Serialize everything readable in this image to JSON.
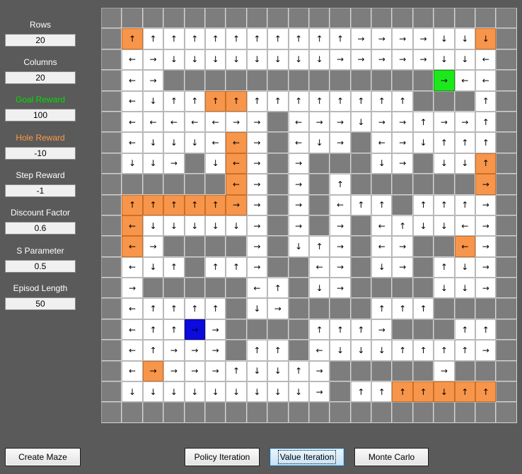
{
  "params": [
    {
      "id": "rows",
      "label": "Rows",
      "value": "20",
      "color": "#ffffff"
    },
    {
      "id": "columns",
      "label": "Columns",
      "value": "20",
      "color": "#ffffff"
    },
    {
      "id": "goal-reward",
      "label": "Goal Reward",
      "value": "100",
      "color": "#00e000"
    },
    {
      "id": "hole-reward",
      "label": "Hole Reward",
      "value": "-10",
      "color": "#ff9a40"
    },
    {
      "id": "step-reward",
      "label": "Step Reward",
      "value": "-1",
      "color": "#ffffff"
    },
    {
      "id": "discount-factor",
      "label": "Discount Factor",
      "value": "0.6",
      "color": "#ffffff"
    },
    {
      "id": "s-parameter",
      "label": "S Parameter",
      "value": "0.5",
      "color": "#ffffff"
    },
    {
      "id": "episod-length",
      "label": "Episod Length",
      "value": "50",
      "color": "#ffffff"
    }
  ],
  "buttons": {
    "create_maze": "Create Maze",
    "policy_iteration": "Policy Iteration",
    "value_iteration": "Value Iteration",
    "monte_carlo": "Monte Carlo",
    "active": "value_iteration"
  },
  "legend": {
    "w": "open-cell",
    "x": "wall-cell",
    "f": "hole-cell",
    "g": "goal-cell",
    "b": "agent-cell",
    "arrows": {
      "u": "↑",
      "d": "↓",
      "l": "←",
      "r": "→",
      "e": ""
    }
  },
  "colors": {
    "background": "#5a5a5a",
    "wall": "#7d7d7d",
    "open": "#ffffff",
    "hole": "#f7954a",
    "goal": "#1ce81c",
    "agent": "#0b0bde"
  },
  "maze": {
    "rows": 20,
    "cols": 20,
    "cells": [
      [
        "xe",
        "xe",
        "xe",
        "xe",
        "xe",
        "xe",
        "xe",
        "xe",
        "xe",
        "xe",
        "xe",
        "xe",
        "xe",
        "xe",
        "xe",
        "xe",
        "xe",
        "xe",
        "xe",
        "xe"
      ],
      [
        "xe",
        "fu",
        "wu",
        "wu",
        "wu",
        "wu",
        "wu",
        "wu",
        "wu",
        "wu",
        "wu",
        "wu",
        "wr",
        "wr",
        "wr",
        "wr",
        "wd",
        "wd",
        "fd",
        "xe"
      ],
      [
        "xe",
        "wl",
        "wr",
        "wd",
        "wd",
        "wd",
        "wd",
        "wd",
        "wd",
        "wd",
        "wd",
        "wr",
        "wr",
        "wr",
        "wr",
        "wr",
        "wd",
        "wd",
        "wl",
        "xe"
      ],
      [
        "xe",
        "wl",
        "wr",
        "xe",
        "xe",
        "xe",
        "xe",
        "xe",
        "xe",
        "xe",
        "xe",
        "xe",
        "xe",
        "xe",
        "xe",
        "xe",
        "gr",
        "wl",
        "wl",
        "xe"
      ],
      [
        "xe",
        "wl",
        "wd",
        "wu",
        "wu",
        "fu",
        "fu",
        "wu",
        "wu",
        "wu",
        "wu",
        "wu",
        "wu",
        "wu",
        "wu",
        "xe",
        "xe",
        "xe",
        "wu",
        "xe"
      ],
      [
        "xe",
        "wl",
        "wl",
        "wl",
        "wl",
        "wl",
        "wr",
        "wr",
        "xe",
        "wl",
        "wr",
        "wr",
        "wd",
        "wr",
        "wr",
        "wu",
        "wr",
        "wr",
        "wu",
        "xe"
      ],
      [
        "xe",
        "wl",
        "wd",
        "wd",
        "wd",
        "wl",
        "fl",
        "wr",
        "xe",
        "wl",
        "wd",
        "wr",
        "xe",
        "wl",
        "wr",
        "wd",
        "wu",
        "wu",
        "wu",
        "xe"
      ],
      [
        "xe",
        "wd",
        "wd",
        "wr",
        "xe",
        "wd",
        "fl",
        "wr",
        "xe",
        "wr",
        "xe",
        "xe",
        "xe",
        "wd",
        "wr",
        "xe",
        "wd",
        "wd",
        "fu",
        "xe"
      ],
      [
        "xe",
        "xe",
        "xe",
        "xe",
        "xe",
        "xe",
        "fl",
        "wr",
        "xe",
        "wr",
        "xe",
        "wu",
        "xe",
        "xe",
        "xe",
        "xe",
        "xe",
        "xe",
        "fr",
        "xe"
      ],
      [
        "xe",
        "fu",
        "fu",
        "fu",
        "fu",
        "fu",
        "fr",
        "wr",
        "xe",
        "wr",
        "xe",
        "wl",
        "wu",
        "wu",
        "xe",
        "wu",
        "wu",
        "wu",
        "wr",
        "xe"
      ],
      [
        "xe",
        "fl",
        "wd",
        "wd",
        "wd",
        "wd",
        "wd",
        "wr",
        "xe",
        "wr",
        "xe",
        "wr",
        "xe",
        "wl",
        "wu",
        "wd",
        "wd",
        "wl",
        "wr",
        "xe"
      ],
      [
        "xe",
        "fl",
        "wr",
        "xe",
        "xe",
        "xe",
        "xe",
        "wr",
        "xe",
        "wd",
        "wu",
        "wr",
        "xe",
        "wl",
        "wr",
        "xe",
        "xe",
        "fl",
        "wr",
        "xe"
      ],
      [
        "xe",
        "wl",
        "wd",
        "wu",
        "xe",
        "wu",
        "wu",
        "wr",
        "xe",
        "xe",
        "wl",
        "wr",
        "xe",
        "wd",
        "wr",
        "xe",
        "wu",
        "wd",
        "wr",
        "xe"
      ],
      [
        "xe",
        "wr",
        "xe",
        "xe",
        "xe",
        "xe",
        "xe",
        "wl",
        "wu",
        "xe",
        "wd",
        "wr",
        "xe",
        "xe",
        "xe",
        "xe",
        "wd",
        "wd",
        "wr",
        "xe"
      ],
      [
        "xe",
        "wl",
        "wu",
        "wu",
        "wu",
        "wu",
        "xe",
        "wd",
        "wr",
        "xe",
        "xe",
        "xe",
        "xe",
        "wu",
        "wu",
        "wu",
        "xe",
        "xe",
        "xe",
        "xe"
      ],
      [
        "xe",
        "wl",
        "wu",
        "wu",
        "br",
        "wr",
        "xe",
        "xe",
        "xe",
        "xe",
        "wu",
        "wu",
        "wu",
        "wr",
        "xe",
        "xe",
        "xe",
        "wu",
        "wu",
        "xe"
      ],
      [
        "xe",
        "wl",
        "wu",
        "wr",
        "wr",
        "wr",
        "xe",
        "wu",
        "wu",
        "xe",
        "wl",
        "wd",
        "wd",
        "wd",
        "wu",
        "wu",
        "wu",
        "wu",
        "wr",
        "xe"
      ],
      [
        "xe",
        "wl",
        "fr",
        "wr",
        "wr",
        "wr",
        "wu",
        "wd",
        "wd",
        "wu",
        "wr",
        "xe",
        "xe",
        "xe",
        "xe",
        "xe",
        "wr",
        "xe",
        "xe",
        "xe"
      ],
      [
        "xe",
        "wd",
        "wd",
        "wd",
        "wd",
        "wd",
        "wd",
        "wd",
        "wd",
        "wd",
        "wr",
        "xe",
        "wu",
        "wu",
        "fu",
        "fu",
        "fd",
        "fu",
        "fu",
        "xe"
      ],
      [
        "xe",
        "xe",
        "xe",
        "xe",
        "xe",
        "xe",
        "xe",
        "xe",
        "xe",
        "xe",
        "xe",
        "xe",
        "xe",
        "xe",
        "xe",
        "xe",
        "xe",
        "xe",
        "xe",
        "xe"
      ]
    ]
  }
}
